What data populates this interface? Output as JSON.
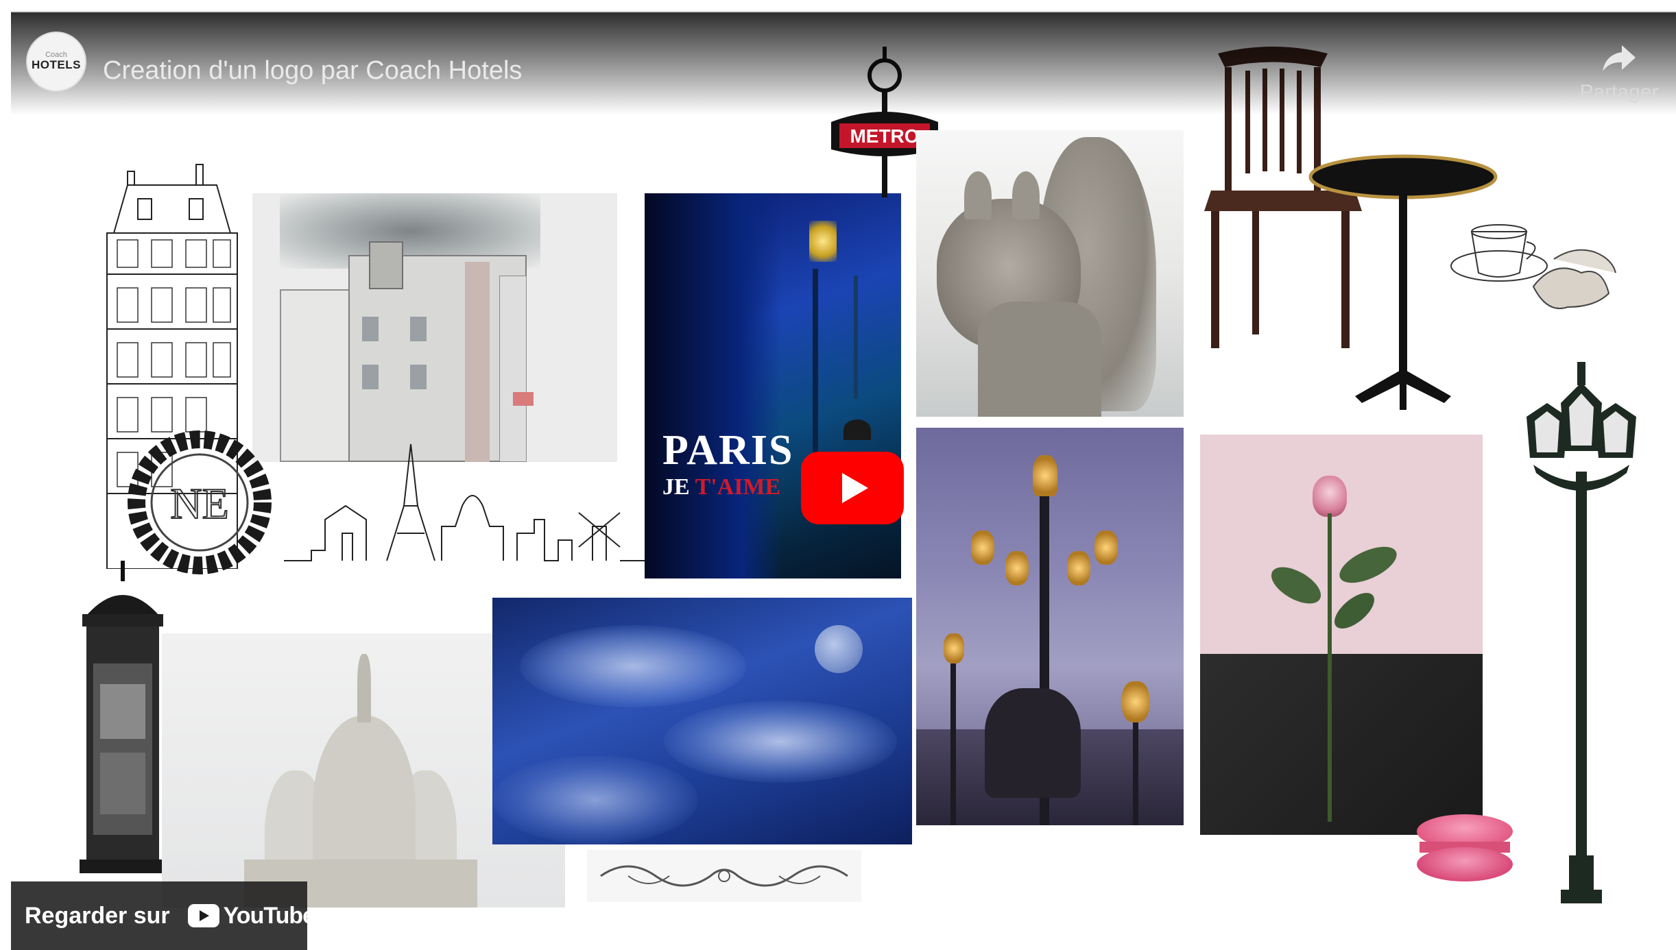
{
  "video": {
    "title": "Creation d'un logo par Coach Hotels",
    "channel": {
      "avatar_line1": "Coach",
      "avatar_line2": "HOTELS"
    }
  },
  "share": {
    "label": "Partager",
    "icon": "share-arrow-icon"
  },
  "player": {
    "play_icon": "youtube-play-icon",
    "watch_on_label": "Regarder sur",
    "youtube_wordmark": "YouTube",
    "accent_color": "#ff0000"
  },
  "moodboard": {
    "metro_sign": "METRO",
    "poster_line1": "PARIS",
    "poster_line2_prefix": "JE ",
    "poster_line2_red": "T'AIME"
  }
}
